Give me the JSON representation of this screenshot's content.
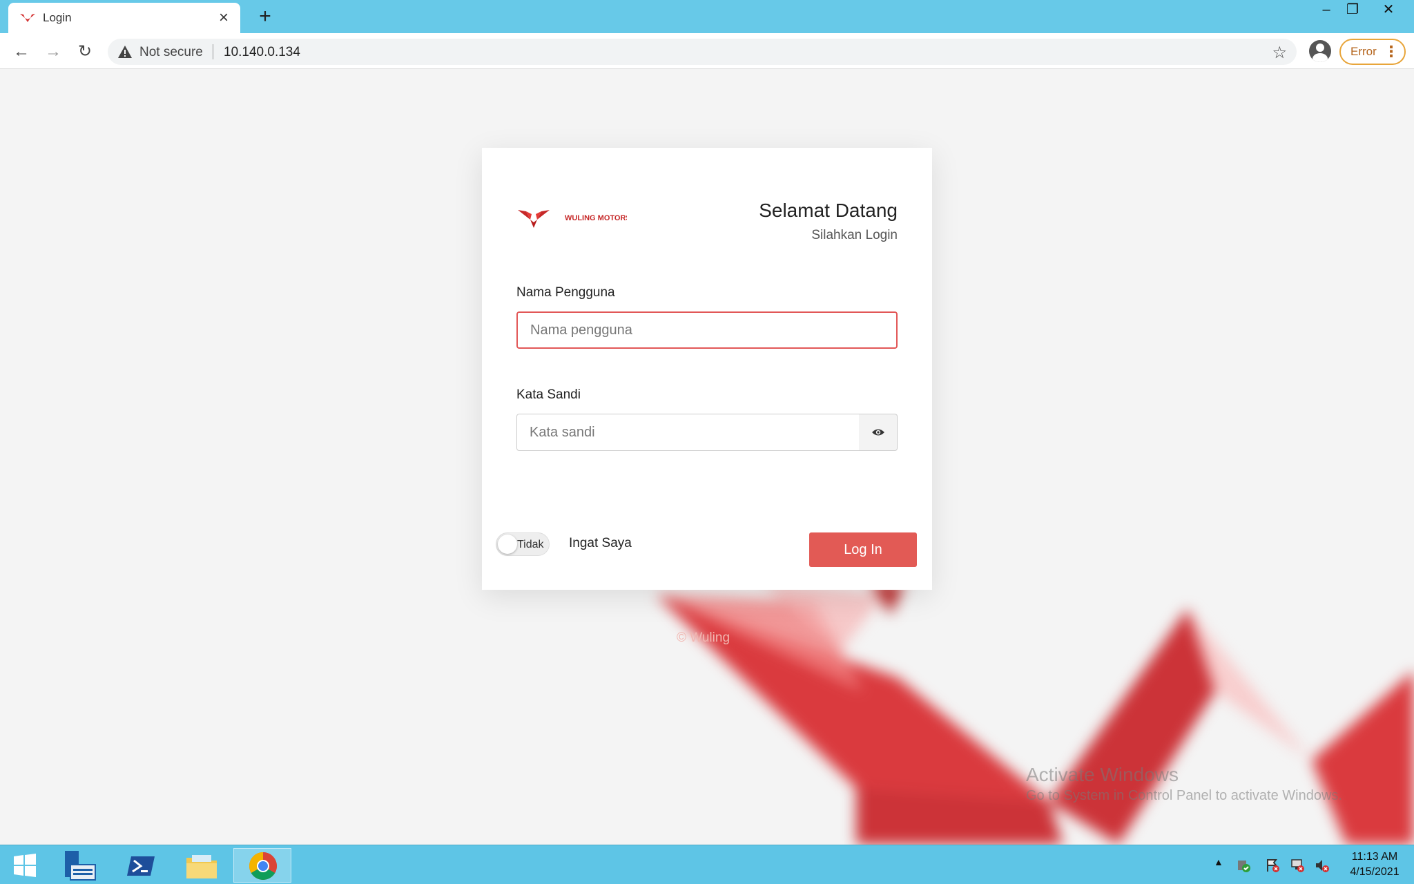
{
  "browser": {
    "tab_title": "Login",
    "not_secure": "Not secure",
    "url": "10.140.0.134",
    "error_label": "Error"
  },
  "login": {
    "logo_text": "WULING MOTORS",
    "welcome_title": "Selamat Datang",
    "welcome_subtitle": "Silahkan Login",
    "username_label": "Nama Pengguna",
    "username_placeholder": "Nama pengguna",
    "password_label": "Kata Sandi",
    "password_placeholder": "Kata sandi",
    "remember_toggle_state": "Tidak",
    "remember_label": "Ingat Saya",
    "login_button": "Log In"
  },
  "footer": {
    "copyright": "© Wuling"
  },
  "watermark": {
    "title": "Activate Windows",
    "subtitle": "Go to System in Control Panel to activate Windows."
  },
  "taskbar": {
    "time": "11:13 AM",
    "date": "4/15/2021"
  },
  "colors": {
    "accent": "#e25a55",
    "tabbar": "#67c9e8",
    "taskbar": "#5ec5e6"
  }
}
